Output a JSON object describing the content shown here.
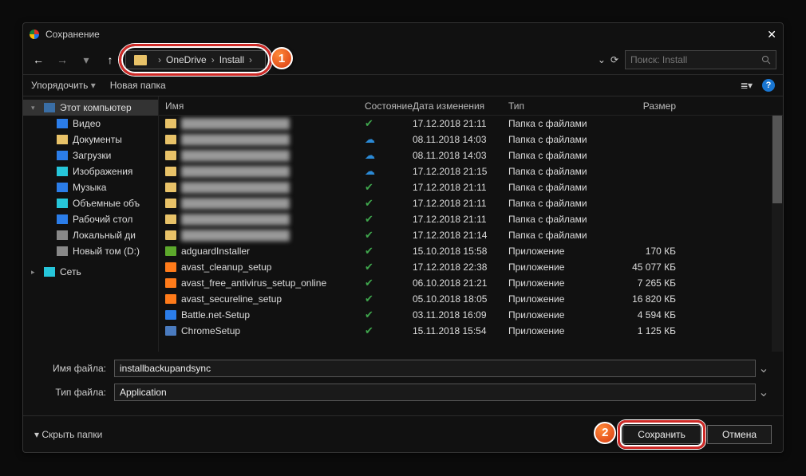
{
  "title": "Сохранение",
  "breadcrumb": {
    "root": "OneDrive",
    "leaf": "Install"
  },
  "search": {
    "placeholder": "Поиск: Install"
  },
  "toolbar": {
    "organize": "Упорядочить",
    "newfolder": "Новая папка"
  },
  "columns": {
    "name": "Имя",
    "state": "Состояние",
    "date": "Дата изменения",
    "type": "Тип",
    "size": "Размер"
  },
  "tree": {
    "root": "Этот компьютер",
    "items": [
      {
        "label": "Видео",
        "ico": "f-blue"
      },
      {
        "label": "Документы",
        "ico": "f-orange"
      },
      {
        "label": "Загрузки",
        "ico": "f-blue"
      },
      {
        "label": "Изображения",
        "ico": "f-cyan"
      },
      {
        "label": "Музыка",
        "ico": "f-blue"
      },
      {
        "label": "Объемные объ",
        "ico": "f-cyan"
      },
      {
        "label": "Рабочий стол",
        "ico": "f-blue"
      },
      {
        "label": "Локальный ди",
        "ico": "f-gray"
      },
      {
        "label": "Новый том (D:)",
        "ico": "f-gray"
      }
    ],
    "net": "Сеть"
  },
  "files": [
    {
      "blur": true,
      "ico": "",
      "state": "ok",
      "date": "17.12.2018 21:11",
      "type": "Папка с файлами",
      "size": ""
    },
    {
      "blur": true,
      "ico": "",
      "state": "cloud",
      "date": "08.11.2018 14:03",
      "type": "Папка с файлами",
      "size": ""
    },
    {
      "blur": true,
      "ico": "",
      "state": "cloud",
      "date": "08.11.2018 14:03",
      "type": "Папка с файлами",
      "size": ""
    },
    {
      "blur": true,
      "ico": "",
      "state": "cloud",
      "date": "17.12.2018 21:15",
      "type": "Папка с файлами",
      "size": ""
    },
    {
      "blur": true,
      "ico": "",
      "state": "ok",
      "date": "17.12.2018 21:11",
      "type": "Папка с файлами",
      "size": ""
    },
    {
      "blur": true,
      "ico": "",
      "state": "ok",
      "date": "17.12.2018 21:11",
      "type": "Папка с файлами",
      "size": ""
    },
    {
      "blur": true,
      "ico": "",
      "state": "ok",
      "date": "17.12.2018 21:11",
      "type": "Папка с файлами",
      "size": ""
    },
    {
      "blur": true,
      "ico": "",
      "state": "ok",
      "date": "17.12.2018 21:14",
      "type": "Папка с файлами",
      "size": ""
    },
    {
      "name": "adguardInstaller",
      "ico": "gr",
      "state": "ok",
      "date": "15.10.2018 15:58",
      "type": "Приложение",
      "size": "170 КБ"
    },
    {
      "name": "avast_cleanup_setup",
      "ico": "or",
      "state": "ok",
      "date": "17.12.2018 22:38",
      "type": "Приложение",
      "size": "45 077 КБ"
    },
    {
      "name": "avast_free_antivirus_setup_online",
      "ico": "or",
      "state": "ok",
      "date": "06.10.2018 21:21",
      "type": "Приложение",
      "size": "7 265 КБ"
    },
    {
      "name": "avast_secureline_setup",
      "ico": "or",
      "state": "ok",
      "date": "05.10.2018 18:05",
      "type": "Приложение",
      "size": "16 820 КБ"
    },
    {
      "name": "Battle.net-Setup",
      "ico": "bl",
      "state": "ok",
      "date": "03.11.2018 16:09",
      "type": "Приложение",
      "size": "4 594 КБ"
    },
    {
      "name": "ChromeSetup",
      "ico": "app",
      "state": "ok",
      "date": "15.11.2018 15:54",
      "type": "Приложение",
      "size": "1 125 КБ"
    }
  ],
  "form": {
    "name_label": "Имя файла:",
    "name_value": "installbackupandsync",
    "type_label": "Тип файла:",
    "type_value": "Application"
  },
  "footer": {
    "hide": "Скрыть папки",
    "save": "Сохранить",
    "cancel": "Отмена"
  }
}
